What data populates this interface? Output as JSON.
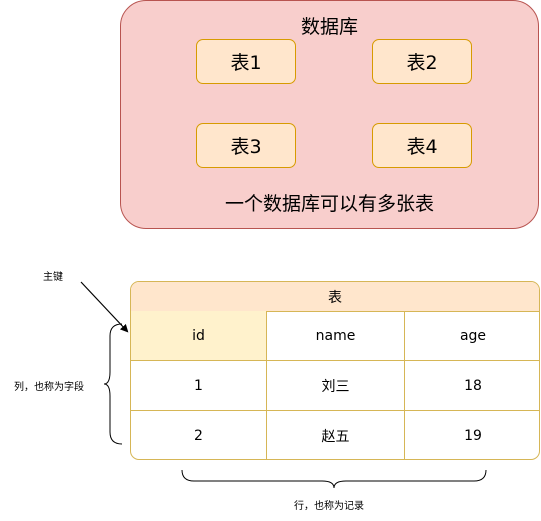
{
  "database": {
    "title": "数据库",
    "tables": [
      "表1",
      "表2",
      "表3",
      "表4"
    ],
    "caption": "一个数据库可以有多张表"
  },
  "table": {
    "title": "表",
    "columns": [
      "id",
      "name",
      "age"
    ],
    "rows": [
      [
        "1",
        "刘三",
        "18"
      ],
      [
        "2",
        "赵五",
        "19"
      ]
    ]
  },
  "annotations": {
    "primary_key": "主键",
    "columns_note": "列，也称为字段",
    "rows_note": "行，也称为记录"
  },
  "colors": {
    "db_fill": "#f8cecc",
    "db_stroke": "#b85450",
    "table_box_fill": "#ffe6cc",
    "table_box_stroke": "#d79b00",
    "table_stroke": "#d6b656",
    "pk_fill": "#fff2cc"
  }
}
